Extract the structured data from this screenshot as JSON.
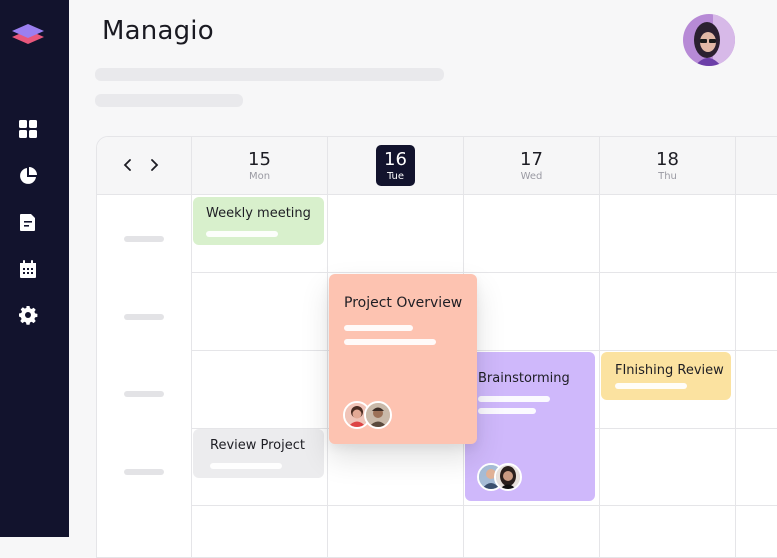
{
  "app": {
    "title": "Managio"
  },
  "sidebar": {
    "items": [
      {
        "icon": "dashboard-grid-icon"
      },
      {
        "icon": "pie-chart-icon"
      },
      {
        "icon": "document-icon"
      },
      {
        "icon": "calendar-icon"
      },
      {
        "icon": "gear-icon"
      }
    ]
  },
  "calendar": {
    "days": [
      {
        "num": "15",
        "name": "Mon"
      },
      {
        "num": "16",
        "name": "Tue"
      },
      {
        "num": "17",
        "name": "Wed"
      },
      {
        "num": "18",
        "name": "Thu"
      }
    ],
    "active_day": "16",
    "events": [
      {
        "title": "Weekly meeting",
        "color": "#d8f0cc"
      },
      {
        "title": "Project Overview",
        "color": "#fdc3b1"
      },
      {
        "title": "Brainstorming",
        "color": "#cfb8fb"
      },
      {
        "title": "FInishing Review",
        "color": "#fbe2a0"
      },
      {
        "title": "Review Project",
        "color": "#ececee"
      }
    ]
  },
  "colors": {
    "sidebar": "#12132d",
    "accent": "#12132d"
  }
}
